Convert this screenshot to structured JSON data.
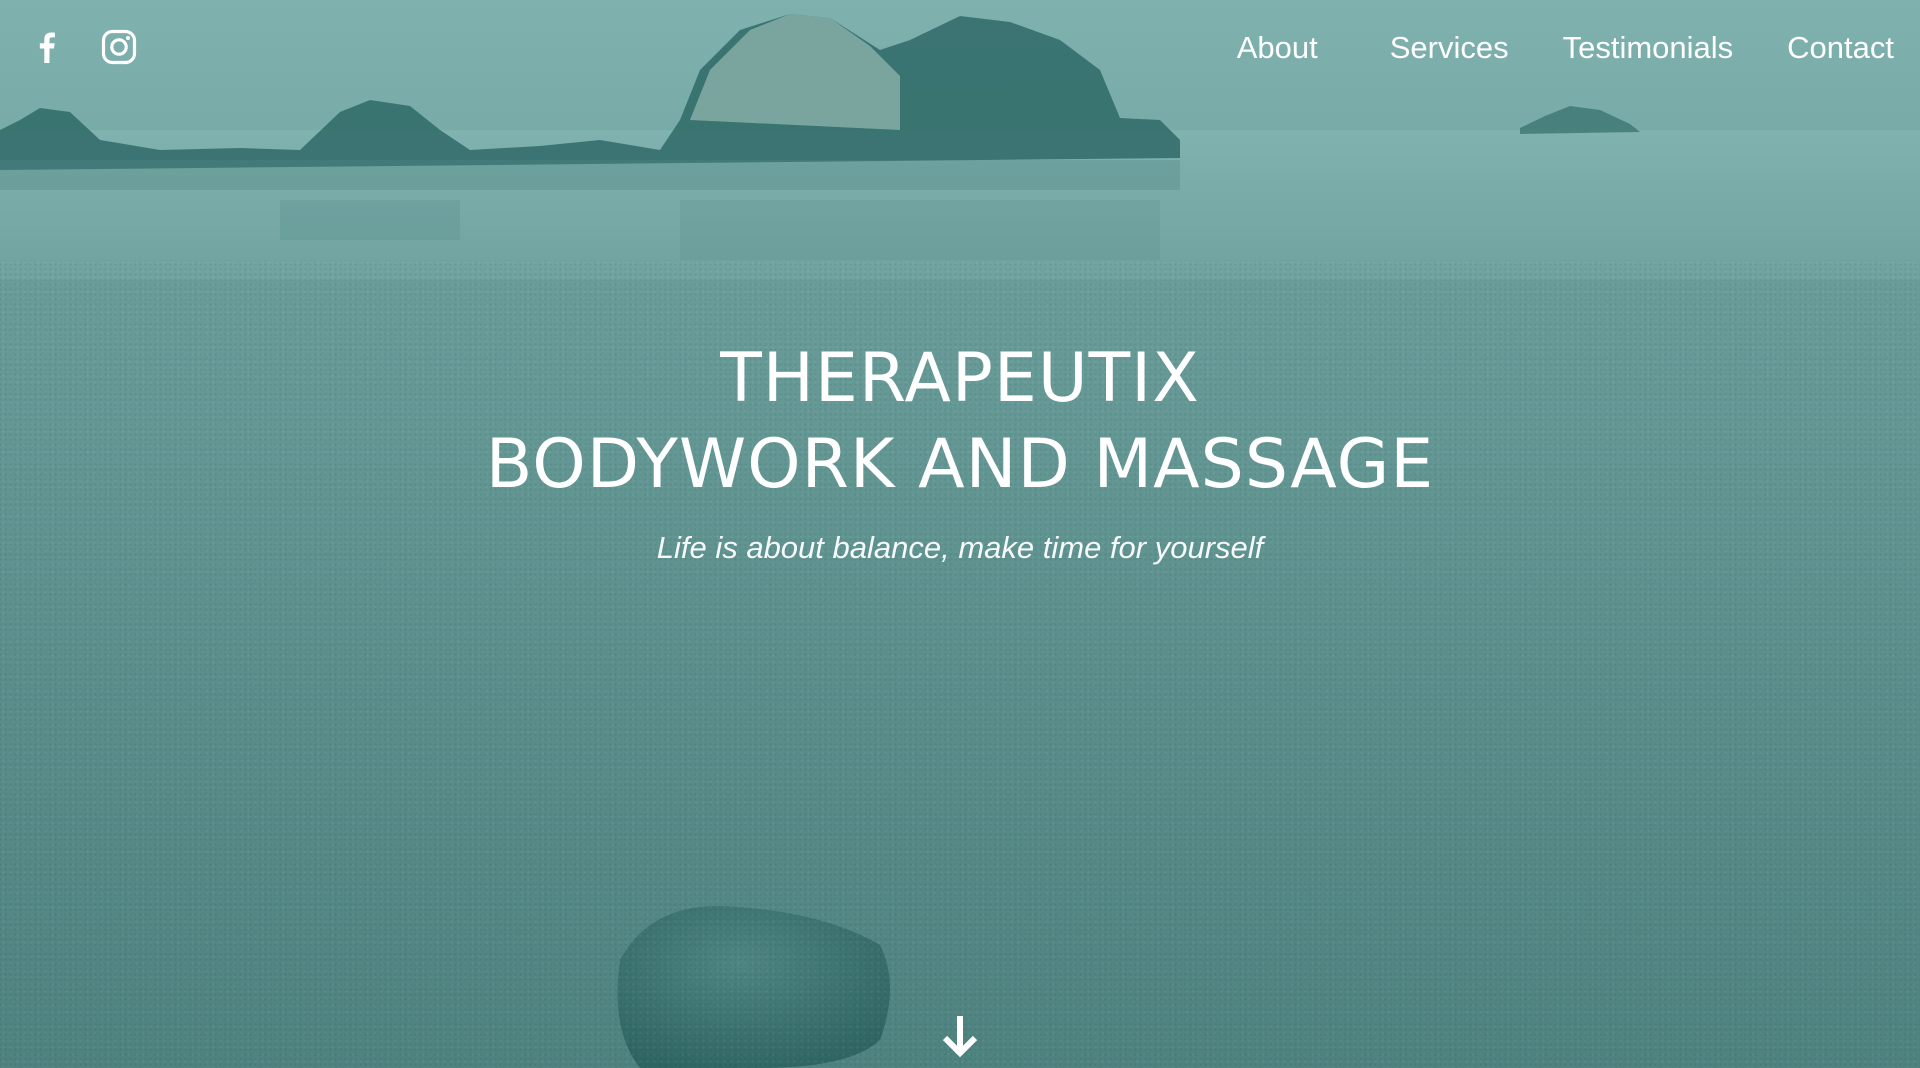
{
  "header": {
    "social": [
      {
        "name": "facebook",
        "icon": "facebook-icon"
      },
      {
        "name": "instagram",
        "icon": "instagram-icon"
      }
    ],
    "nav": [
      "About",
      "Services",
      "Testimonials",
      "Contact"
    ]
  },
  "hero": {
    "title_line1": "THERAPEUTIX",
    "title_line2": "BODYWORK AND MASSAGE",
    "tagline": "Life is about balance, make time for yourself",
    "scroll_icon": "arrow-down-icon",
    "overlay_color": "#5f9693"
  }
}
